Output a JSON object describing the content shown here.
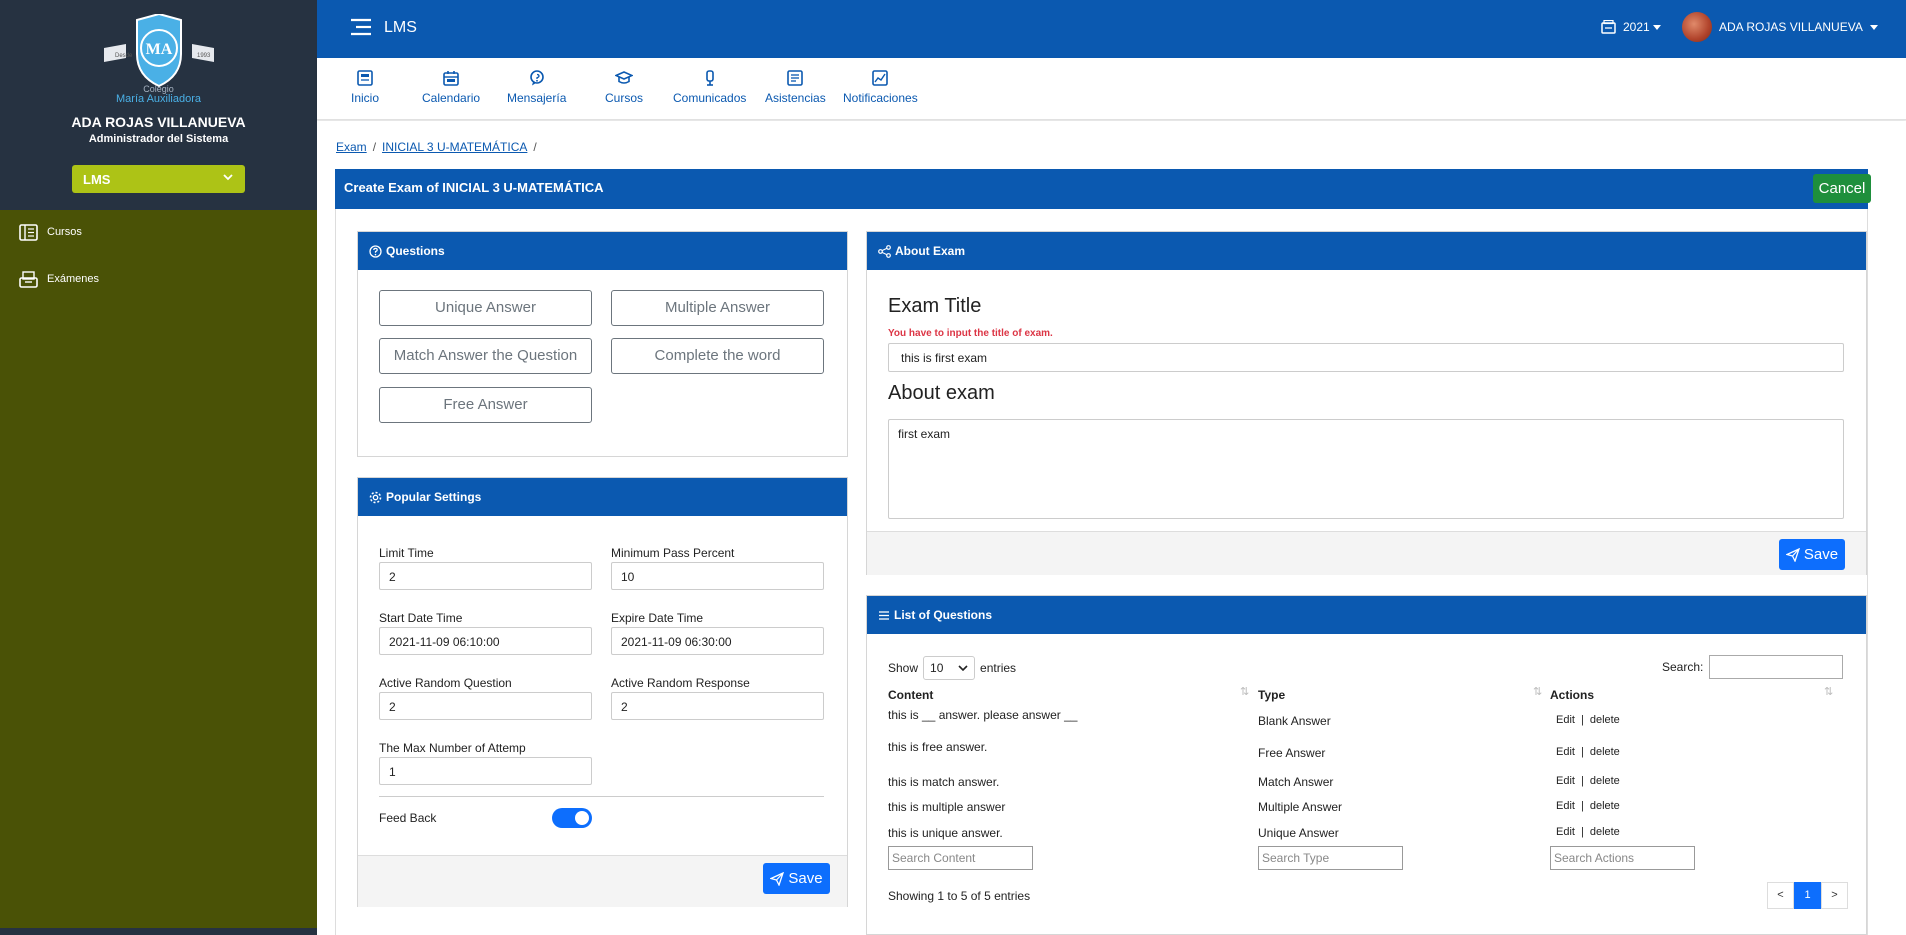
{
  "sidebar": {
    "logo_caption": "Colegio",
    "logo_name": "María Auxiliadora",
    "user_name": "ADA ROJAS VILLANUEVA",
    "user_role": "Administrador del Sistema",
    "module_select": "LMS",
    "items": [
      {
        "label": "Cursos",
        "icon": "book-icon"
      },
      {
        "label": "Exámenes",
        "icon": "exam-tray-icon"
      }
    ]
  },
  "topbar": {
    "title": "LMS",
    "year": "2021",
    "user": "ADA ROJAS VILLANUEVA"
  },
  "nav": [
    {
      "label": "Inicio",
      "icon": "home-icon"
    },
    {
      "label": "Calendario",
      "icon": "calendar-icon"
    },
    {
      "label": "Mensajería",
      "icon": "message-icon"
    },
    {
      "label": "Cursos",
      "icon": "graduation-cap-icon"
    },
    {
      "label": "Comunicados",
      "icon": "announcement-icon"
    },
    {
      "label": "Asistencias",
      "icon": "attendance-icon"
    },
    {
      "label": "Notificaciones",
      "icon": "notification-icon"
    }
  ],
  "breadcrumb": [
    "Exam",
    "INICIAL 3 U-MATEMÁTICA"
  ],
  "page": {
    "header": "Create Exam of INICIAL 3 U-MATEMÁTICA",
    "cancel": "Cancel"
  },
  "questions": {
    "title": "Questions",
    "buttons": [
      "Unique Answer",
      "Multiple Answer",
      "Match Answer the Question",
      "Complete the word",
      "Free Answer"
    ]
  },
  "settings": {
    "title": "Popular Settings",
    "limit_time_label": "Limit Time",
    "limit_time": "2",
    "min_pass_label": "Minimum Pass Percent",
    "min_pass": "10",
    "start_label": "Start Date Time",
    "start": "2021-11-09 06:10:00",
    "expire_label": "Expire Date Time",
    "expire": "2021-11-09 06:30:00",
    "random_q_label": "Active Random Question",
    "random_q": "2",
    "random_r_label": "Active Random Response",
    "random_r": "2",
    "max_attempt_label": "The Max Number of Attemp",
    "max_attempt": "1",
    "feedback_label": "Feed Back",
    "feedback_on": true,
    "save": "Save"
  },
  "about": {
    "title": "About Exam",
    "exam_title_label": "Exam Title",
    "error": "You have to input the title of exam.",
    "exam_title": "this is first exam",
    "about_label": "About exam",
    "about_text": "first exam",
    "save": "Save"
  },
  "list": {
    "title": "List of Questions",
    "show": "Show",
    "entries_value": "10",
    "entries": "entries",
    "search_label": "Search:",
    "columns": [
      "Content",
      "Type",
      "Actions"
    ],
    "rows": [
      {
        "content": "this is __ answer. please answer __",
        "type": "Blank Answer"
      },
      {
        "content": "this is free answer.",
        "type": "Free Answer"
      },
      {
        "content": "this is match answer.",
        "type": "Match Answer"
      },
      {
        "content": "this is multiple answer",
        "type": "Multiple Answer"
      },
      {
        "content": "this is unique answer.",
        "type": "Unique Answer"
      }
    ],
    "edit": "Edit",
    "sep": "|",
    "delete": "delete",
    "search_content": "Search Content",
    "search_type": "Search Type",
    "search_actions": "Search Actions",
    "showing": "Showing 1 to 5 of 5 entries",
    "prev": "<",
    "page": "1",
    "next": ">"
  }
}
